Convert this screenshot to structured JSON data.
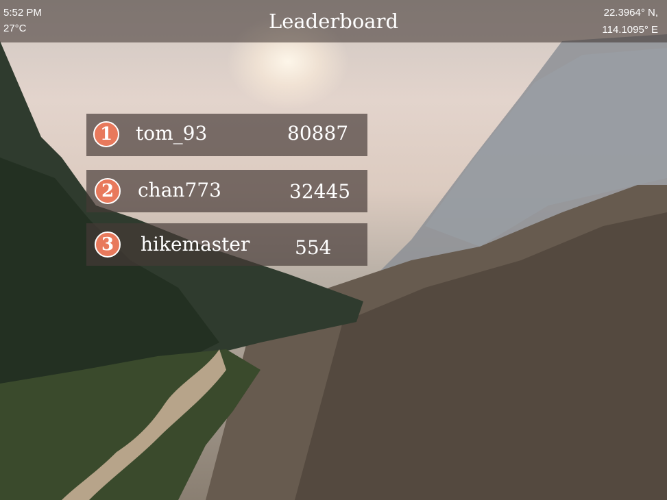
{
  "status": {
    "time": "5:52 PM",
    "temperature": "27°C",
    "latitude": "22.3964° N,",
    "longitude": "114.1095° E"
  },
  "header": {
    "title": "Leaderboard"
  },
  "leaderboard": [
    {
      "rank": "1",
      "name": "tom_93",
      "score": "80887"
    },
    {
      "rank": "2",
      "name": "chan773",
      "score": "32445"
    },
    {
      "rank": "3",
      "name": "hikemaster",
      "score": "554"
    }
  ],
  "colors": {
    "rank_badge": "#e8795c",
    "row_bg": "rgba(70,58,54,0.68)"
  }
}
